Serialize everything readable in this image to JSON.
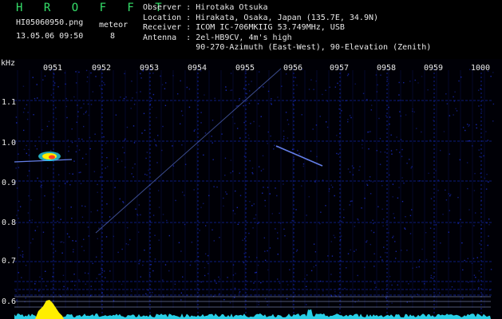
{
  "header": {
    "brand": "H R O F F T",
    "file_name": "HI05060950.png",
    "timestamp": "13.05.06 09:50",
    "meteor_label": "meteor",
    "meteor_count": "8",
    "observer": "Observer : Hirotaka Otsuka",
    "location": "Location : Hirakata, Osaka, Japan (135.7E, 34.9N)",
    "receiver": "Receiver : ICOM IC-706MKIIG 53.749MHz, USB",
    "antenna": "Antenna  : 2el-HB9CV, 4m's high",
    "antenna2": "           90-270-Azimuth (East-West), 90-Elevation (Zenith)"
  },
  "spectrogram": {
    "y_unit": "kHz",
    "time_ticks": [
      "0951",
      "0952",
      "0953",
      "0954",
      "0955",
      "0956",
      "0957",
      "0958",
      "0959",
      "1000"
    ],
    "freq_ticks": [
      "1.1",
      "1.0",
      "0.9",
      "0.8",
      "0.7",
      "0.6"
    ],
    "colors": {
      "background": "#000006",
      "noise": "#1c2ec8",
      "grid": "#0d1c7a",
      "trace": "#6f8cff",
      "signal_hot": "#ffee00",
      "signal_warm": "#ff3b1f",
      "signal_cool": "#2ff0ff",
      "spectrum": "#2ee6ff"
    }
  }
}
